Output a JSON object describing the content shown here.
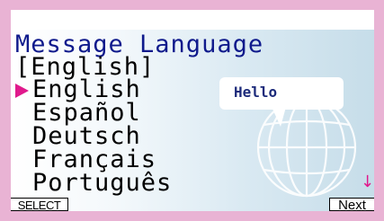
{
  "screen": {
    "title": "Message Language",
    "current_language": "[English]",
    "selected_index": 0,
    "languages": [
      "English",
      "Español",
      "Deutsch",
      "Français",
      "Português"
    ],
    "bubble_text": "Hello",
    "scroll_indicator": "↓"
  },
  "function_keys": {
    "left": "SELECT",
    "right": "Next"
  },
  "colors": {
    "title": "#0f1a8c",
    "marker": "#e0198c",
    "frame": "#e9b3d4"
  }
}
